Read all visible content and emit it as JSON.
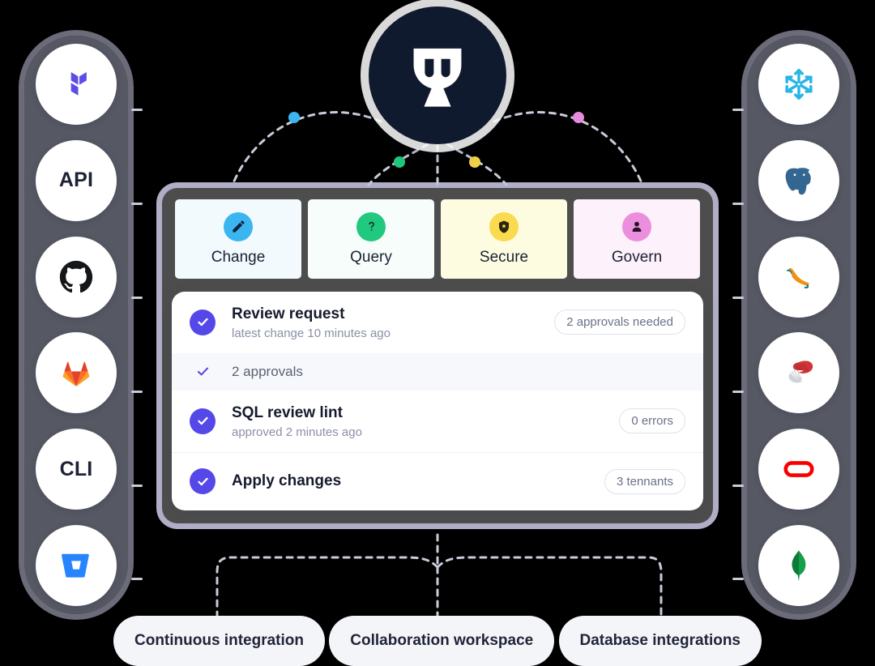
{
  "hub": {
    "name": "bytebase-logo",
    "background": "#101a2e"
  },
  "left_rail": {
    "name": "integrations-rail-left",
    "items": [
      {
        "icon": "terraform-icon",
        "label": "",
        "type": "svg"
      },
      {
        "icon": "api-icon",
        "label": "API",
        "type": "text"
      },
      {
        "icon": "github-icon",
        "label": "",
        "type": "svg"
      },
      {
        "icon": "gitlab-icon",
        "label": "",
        "type": "svg"
      },
      {
        "icon": "cli-icon",
        "label": "CLI",
        "type": "text"
      },
      {
        "icon": "bitbucket-icon",
        "label": "",
        "type": "svg"
      }
    ]
  },
  "right_rail": {
    "name": "databases-rail-right",
    "items": [
      {
        "icon": "snowflake-icon",
        "label": "",
        "type": "svg"
      },
      {
        "icon": "postgresql-icon",
        "label": "",
        "type": "svg"
      },
      {
        "icon": "mysql-icon",
        "label": "",
        "type": "svg"
      },
      {
        "icon": "sqlserver-icon",
        "label": "",
        "type": "svg"
      },
      {
        "icon": "oracle-icon",
        "label": "",
        "type": "svg"
      },
      {
        "icon": "mongodb-icon",
        "label": "",
        "type": "svg"
      }
    ]
  },
  "categories": [
    {
      "label": "Change",
      "icon": "pencil-icon",
      "bubble_color": "#3ab5f0",
      "card_bg": "#f2fafe",
      "dot_color": "#3ab5f0"
    },
    {
      "label": "Query",
      "icon": "question-mark-icon",
      "bubble_color": "#20c97e",
      "card_bg": "#f6fdfa",
      "dot_color": "#20c97e"
    },
    {
      "label": "Secure",
      "icon": "shield-icon",
      "bubble_color": "#fada4e",
      "card_bg": "#fdfbe0",
      "dot_color": "#f3d64a"
    },
    {
      "label": "Govern",
      "icon": "person-icon",
      "bubble_color": "#ec8ede",
      "card_bg": "#fdf1fb",
      "dot_color": "#e68ade"
    }
  ],
  "tasks": [
    {
      "title": "Review request",
      "meta": "latest change 10 minutes ago",
      "badge": "2 approvals needed",
      "state": "done",
      "variant": "main"
    },
    {
      "title": "2 approvals",
      "meta": "",
      "badge": "",
      "state": "done",
      "variant": "sub"
    },
    {
      "title": "SQL review lint",
      "meta": "approved 2 minutes ago",
      "badge": "0 errors",
      "state": "done",
      "variant": "main"
    },
    {
      "title": "Apply changes",
      "meta": "",
      "badge": "3 tennants",
      "state": "done",
      "variant": "main"
    }
  ],
  "bottom_pills": [
    {
      "label": "Continuous integration"
    },
    {
      "label": "Collaboration workspace"
    },
    {
      "label": "Database integrations"
    }
  ],
  "colors": {
    "accent_purple": "#5548e8",
    "wire": "#c9cbda",
    "panel_border": "#c1c0dc",
    "rail_bg": "#9da0b4"
  }
}
